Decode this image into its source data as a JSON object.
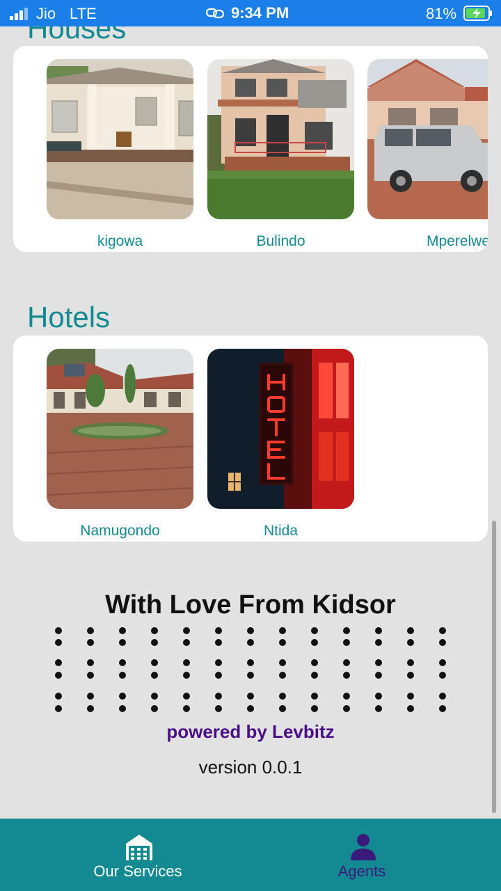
{
  "status_bar": {
    "carrier": "Jio",
    "network": "LTE",
    "time": "9:34 PM",
    "battery": "81%"
  },
  "sections": {
    "houses": {
      "title": "Houses",
      "items": [
        {
          "label": "kigowa"
        },
        {
          "label": "Bulindo"
        },
        {
          "label": "Mperelwe"
        }
      ]
    },
    "hotels": {
      "title": "Hotels",
      "items": [
        {
          "label": "Namugondo"
        },
        {
          "label": "Ntida"
        }
      ]
    }
  },
  "footer": {
    "love": "With Love From Kidsor",
    "powered": "powered by Levbitz",
    "version": "version 0.0.1"
  },
  "nav": {
    "services_label": "Our Services",
    "agents_label": "Agents"
  },
  "colors": {
    "accent": "#138a91",
    "status_bar": "#1a7fe8",
    "powered": "#4a0e86"
  }
}
